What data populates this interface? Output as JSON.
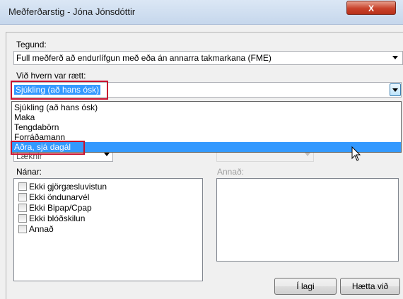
{
  "window": {
    "title": "Meðferðarstig - Jóna Jónsdóttir",
    "close_label": "X"
  },
  "tegund": {
    "label": "Tegund:",
    "value": "Full meðferð að endurlífgun með eða án annarra takmarkana (FME)"
  },
  "vid_hvern": {
    "label": "Við hvern var rætt:",
    "value": "Sjúkling (að hans ósk)",
    "options": [
      "Sjúkling (að hans ósk)",
      "Maka",
      "Tengdabörn",
      "Forráðamann",
      "Aðra, sjá dagál"
    ],
    "highlighted_index": 4
  },
  "partial_combo_text": "Læknir",
  "nanar": {
    "label": "Nánar:",
    "items": [
      "Ekki gjörgæsluvistun",
      "Ekki öndunarvél",
      "Ekki Bipap/Cpap",
      "Ekki blóðskilun",
      "Annað"
    ]
  },
  "annad": {
    "label": "Annað:"
  },
  "buttons": {
    "ok": "Í lagi",
    "cancel": "Hætta við"
  }
}
